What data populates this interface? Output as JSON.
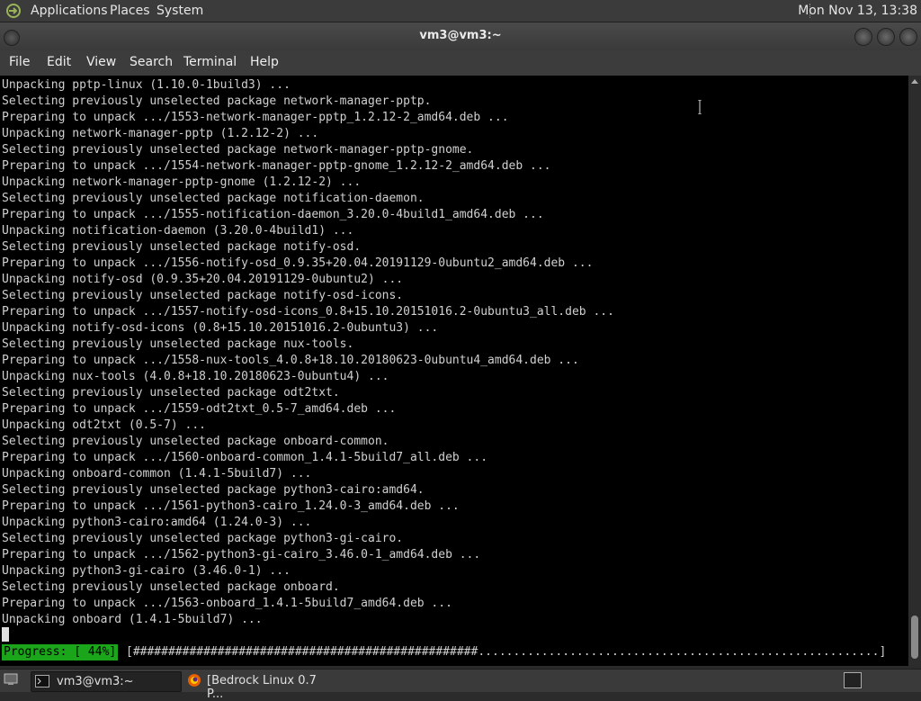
{
  "top_panel": {
    "menu": [
      "Applications",
      "Places",
      "System"
    ],
    "clock": "Mon Nov 13, 13:38"
  },
  "window": {
    "title": "vm3@vm3:~"
  },
  "menubar": [
    "File",
    "Edit",
    "View",
    "Search",
    "Terminal",
    "Help"
  ],
  "terminal": {
    "lines": [
      "Unpacking pptp-linux (1.10.0-1build3) ...",
      "Selecting previously unselected package network-manager-pptp.",
      "Preparing to unpack .../1553-network-manager-pptp_1.2.12-2_amd64.deb ...",
      "Unpacking network-manager-pptp (1.2.12-2) ...",
      "Selecting previously unselected package network-manager-pptp-gnome.",
      "Preparing to unpack .../1554-network-manager-pptp-gnome_1.2.12-2_amd64.deb ...",
      "Unpacking network-manager-pptp-gnome (1.2.12-2) ...",
      "Selecting previously unselected package notification-daemon.",
      "Preparing to unpack .../1555-notification-daemon_3.20.0-4build1_amd64.deb ...",
      "Unpacking notification-daemon (3.20.0-4build1) ...",
      "Selecting previously unselected package notify-osd.",
      "Preparing to unpack .../1556-notify-osd_0.9.35+20.04.20191129-0ubuntu2_amd64.deb ...",
      "Unpacking notify-osd (0.9.35+20.04.20191129-0ubuntu2) ...",
      "Selecting previously unselected package notify-osd-icons.",
      "Preparing to unpack .../1557-notify-osd-icons_0.8+15.10.20151016.2-0ubuntu3_all.deb ...",
      "Unpacking notify-osd-icons (0.8+15.10.20151016.2-0ubuntu3) ...",
      "Selecting previously unselected package nux-tools.",
      "Preparing to unpack .../1558-nux-tools_4.0.8+18.10.20180623-0ubuntu4_amd64.deb ...",
      "Unpacking nux-tools (4.0.8+18.10.20180623-0ubuntu4) ...",
      "Selecting previously unselected package odt2txt.",
      "Preparing to unpack .../1559-odt2txt_0.5-7_amd64.deb ...",
      "Unpacking odt2txt (0.5-7) ...",
      "Selecting previously unselected package onboard-common.",
      "Preparing to unpack .../1560-onboard-common_1.4.1-5build7_all.deb ...",
      "Unpacking onboard-common (1.4.1-5build7) ...",
      "Selecting previously unselected package python3-cairo:amd64.",
      "Preparing to unpack .../1561-python3-cairo_1.24.0-3_amd64.deb ...",
      "Unpacking python3-cairo:amd64 (1.24.0-3) ...",
      "Selecting previously unselected package python3-gi-cairo.",
      "Preparing to unpack .../1562-python3-gi-cairo_3.46.0-1_amd64.deb ...",
      "Unpacking python3-gi-cairo (3.46.0-1) ...",
      "Selecting previously unselected package onboard.",
      "Preparing to unpack .../1563-onboard_1.4.1-5build7_amd64.deb ...",
      "Unpacking onboard (1.4.1-5build7) ..."
    ],
    "progress_label": "Progress: [ 44%]",
    "progress_bar": "[#################################################.........................................................]",
    "progress_percent": 44
  },
  "taskbar": {
    "tasks": [
      "vm3@vm3:~",
      "[Bedrock Linux 0.7 P..."
    ]
  },
  "colors": {
    "terminal_bg": "#000000",
    "terminal_fg": "#d0d0d0",
    "progress_green": "#1aa51a",
    "panel_bg": "#3b3b3b"
  },
  "icons": [
    "gnome-foot-icon",
    "window-menu-icon",
    "minimize-icon",
    "maximize-icon",
    "close-icon",
    "show-desktop-icon",
    "terminal-icon",
    "firefox-icon",
    "workspace-icon",
    "text-cursor-icon"
  ]
}
